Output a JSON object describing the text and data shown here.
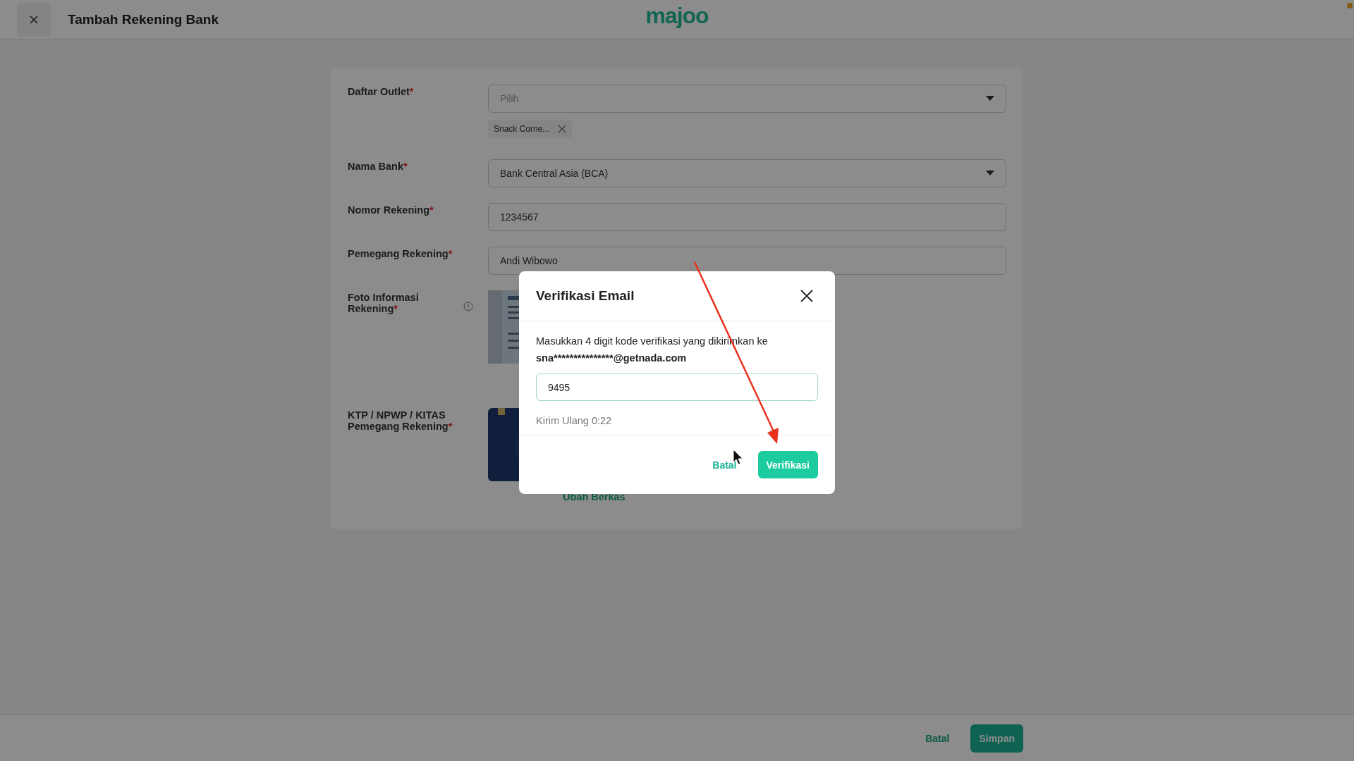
{
  "header": {
    "title": "Tambah Rekening Bank",
    "logo": "majoo"
  },
  "form": {
    "fields": [
      {
        "kind": "select",
        "label": "Daftar Outlet",
        "required_mark": "*",
        "placeholder": "Pilih",
        "chips": [
          "Snack Corne..."
        ]
      },
      {
        "kind": "select",
        "label": "Nama Bank",
        "required_mark": "*",
        "value": "Bank Central Asia (BCA)"
      },
      {
        "kind": "input",
        "label": "Nomor Rekening",
        "required_mark": "*",
        "value": "1234567"
      },
      {
        "kind": "input",
        "label": "Pemegang Rekening",
        "required_mark": "*",
        "value": "Andi Wibowo"
      },
      {
        "label": "Foto Informasi Rekening",
        "required_mark": "*",
        "info": true
      },
      {
        "label": "KTP / NPWP / KITAS Pemegang Rekening",
        "required_mark": "*",
        "link": "Ubah Berkas"
      }
    ]
  },
  "footer": {
    "buttons": [
      {
        "label": "Batal",
        "kind": "text"
      },
      {
        "label": "Simpan",
        "kind": "primary"
      }
    ]
  },
  "dialog": {
    "title": "Verifikasi Email",
    "message": "Masukkan 4 digit kode verifikasi yang dikirimkan ke",
    "email": "sna***************@getnada.com",
    "code": "9495",
    "resend": "Kirim Ulang 0:22",
    "buttons": [
      {
        "label": "Batal",
        "kind": "text"
      },
      {
        "label": "Verifikasi",
        "kind": "primary"
      }
    ]
  }
}
